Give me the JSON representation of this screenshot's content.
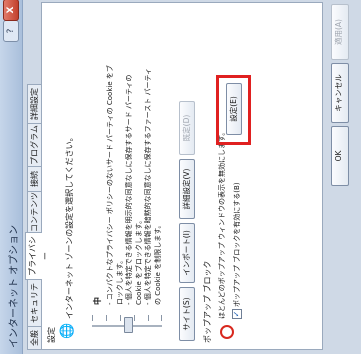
{
  "window": {
    "title": "インターネット オプション",
    "help_label": "?",
    "close_label": "X"
  },
  "tabs": [
    "全般",
    "セキュリティ",
    "プライバシー",
    "コンテンツ",
    "接続",
    "プログラム",
    "詳細設定"
  ],
  "settings": {
    "group_label": "設定",
    "zone_text": "インターネット ゾーンの設定を選択してください。",
    "level_label": "中",
    "description": "- コンパクトなプライバシー ポリシーのないサード パーティの Cookie をブロックします。\n- 個人を特定できる情報を明示的な同意なしに保存するサード パーティの Cookie をブロックします。\n- 個人を特定できる情報を暗黙的な同意なしに保存するファースト パーティの Cookie を制限します。"
  },
  "buttons": {
    "sites": "サイト(S)",
    "import": "インポート(I)",
    "advanced": "詳細設定(V)",
    "default": "既定(D)",
    "popup_settings": "設定(E)",
    "ok": "OK",
    "cancel": "キャンセル",
    "apply": "適用(A)"
  },
  "popup": {
    "group_label": "ポップアップ ブロック",
    "description": "ほとんどのポップアップ ウィンドウの表示を無効にします。",
    "checkbox_label": "ポップアップ ブロックを有効にする(B)",
    "checkbox_checked": true
  },
  "colors": {
    "highlight": "#e02020",
    "accent": "#1e5fb4"
  }
}
